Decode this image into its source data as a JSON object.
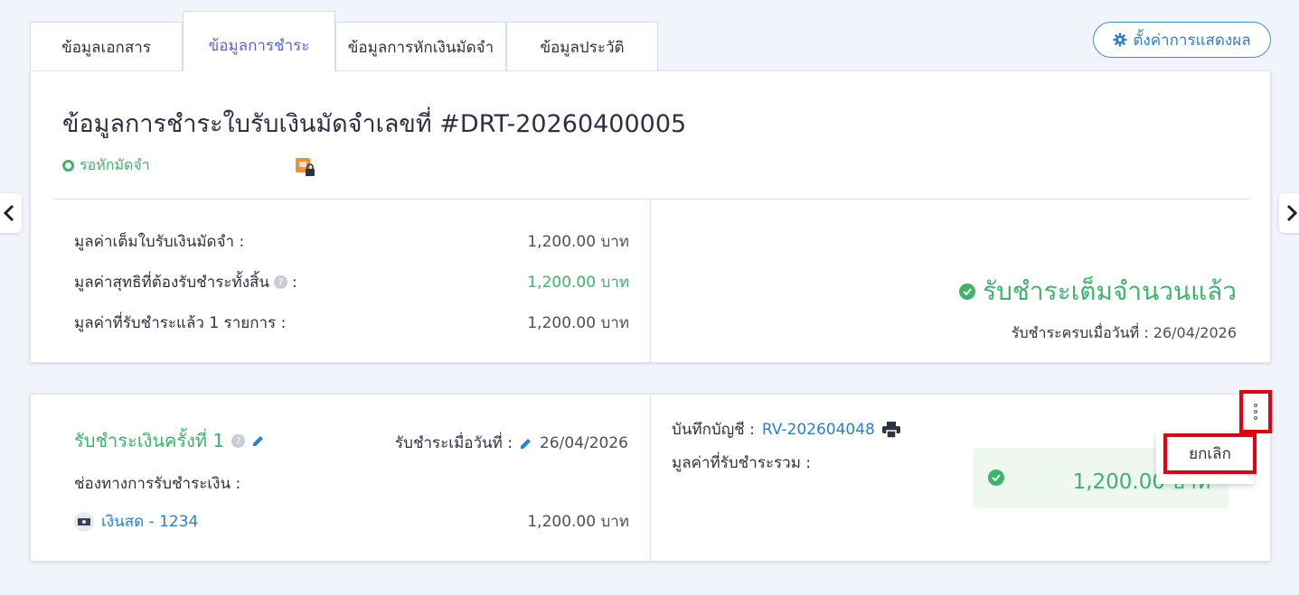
{
  "tabs": [
    {
      "label": "ข้อมูลเอกสาร"
    },
    {
      "label": "ข้อมูลการชำระ"
    },
    {
      "label": "ข้อมูลการหักเงินมัดจำ"
    },
    {
      "label": "ข้อมูลประวัติ"
    }
  ],
  "active_tab": "ข้อมูลการชำระ",
  "display_settings_label": "ตั้งค่าการแสดงผล",
  "summary": {
    "title": "ข้อมูลการชำระใบรับเงินมัดจำเลขที่ #DRT-20260400005",
    "status": "รอหักมัดจำ",
    "rows": [
      {
        "label": "มูลค่าเต็มใบรับเงินมัดจำ :",
        "value": "1,200.00 บาท"
      },
      {
        "label": "มูลค่าสุทธิที่ต้องรับชำระทั้งสิ้น",
        "suffix": ":",
        "value": "1,200.00 บาท"
      },
      {
        "label": "มูลค่าที่รับชำระแล้ว 1 รายการ :",
        "value": "1,200.00 บาท"
      }
    ],
    "paid_status": "รับชำระเต็มจำนวนแล้ว",
    "paid_date_label": "รับชำระครบเมื่อวันที่ :",
    "paid_date": "26/04/2026"
  },
  "payment": {
    "title": "รับชำระเงินครั้งที่ 1",
    "date_label": "รับชำระเมื่อวันที่ :",
    "date": "26/04/2026",
    "channel_label": "ช่องทางการรับชำระเงิน :",
    "channel_name": "เงินสด - 1234",
    "channel_amount": "1,200.00 บาท",
    "record_label": "บันทึกบัญชี :",
    "record_number": "RV-202604048",
    "total_label": "มูลค่าที่รับชำระรวม :",
    "total_amount": "1,200.00 บาท"
  },
  "menu": {
    "cancel_label": "ยกเลิก"
  },
  "colors": {
    "accent_green": "#3fb36b",
    "link_blue": "#2b7fcb",
    "active_tab": "#5b64d6",
    "highlight_red": "#e3000f"
  }
}
